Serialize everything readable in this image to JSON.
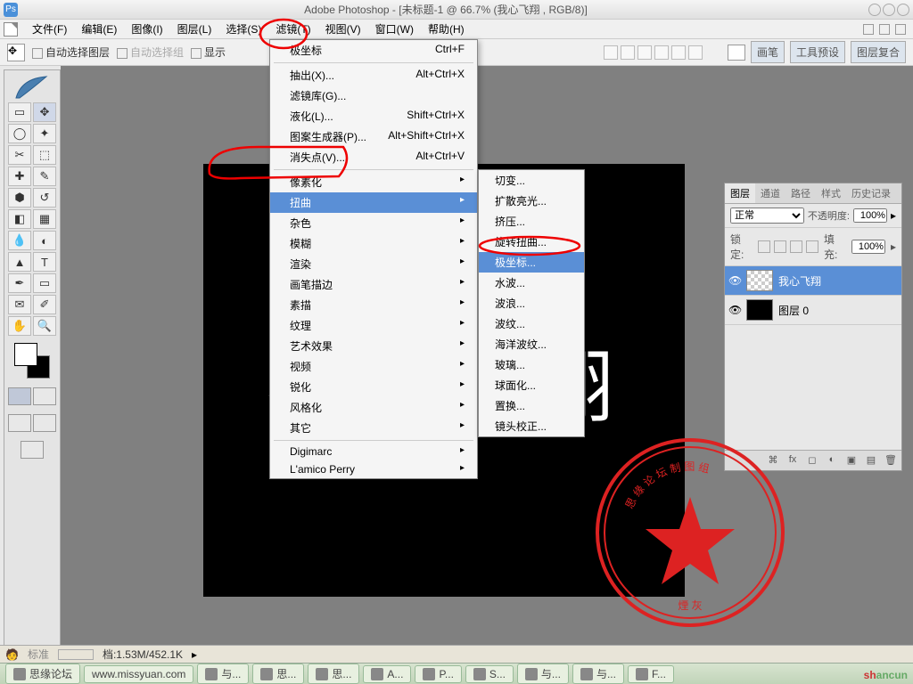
{
  "title": "Adobe Photoshop - [未标题-1 @ 66.7% (我心飞翔  , RGB/8)]",
  "menubar": [
    "文件(F)",
    "编辑(E)",
    "图像(I)",
    "图层(L)",
    "选择(S)",
    "滤镜(T)",
    "视图(V)",
    "窗口(W)",
    "帮助(H)"
  ],
  "optionbar": {
    "auto_select_layer": "自动选择图层",
    "auto_select_group": "自动选择组",
    "show_transform": "显示",
    "right_tabs": [
      "画笔",
      "工具预设",
      "图层复合"
    ]
  },
  "filter_menu": {
    "items": [
      {
        "label": "极坐标",
        "shortcut": "Ctrl+F"
      },
      {
        "sep": true
      },
      {
        "label": "抽出(X)...",
        "shortcut": "Alt+Ctrl+X"
      },
      {
        "label": "滤镜库(G)..."
      },
      {
        "label": "液化(L)...",
        "shortcut": "Shift+Ctrl+X"
      },
      {
        "label": "图案生成器(P)...",
        "shortcut": "Alt+Shift+Ctrl+X"
      },
      {
        "label": "消失点(V)...",
        "shortcut": "Alt+Ctrl+V"
      },
      {
        "sep": true
      },
      {
        "label": "像素化",
        "arrow": true
      },
      {
        "label": "扭曲",
        "arrow": true,
        "highlighted": true
      },
      {
        "label": "杂色",
        "arrow": true
      },
      {
        "label": "模糊",
        "arrow": true
      },
      {
        "label": "渲染",
        "arrow": true
      },
      {
        "label": "画笔描边",
        "arrow": true
      },
      {
        "label": "素描",
        "arrow": true
      },
      {
        "label": "纹理",
        "arrow": true
      },
      {
        "label": "艺术效果",
        "arrow": true
      },
      {
        "label": "视频",
        "arrow": true
      },
      {
        "label": "锐化",
        "arrow": true
      },
      {
        "label": "风格化",
        "arrow": true
      },
      {
        "label": "其它",
        "arrow": true
      },
      {
        "sep": true
      },
      {
        "label": "Digimarc",
        "arrow": true
      },
      {
        "label": "L'amico Perry",
        "arrow": true
      }
    ]
  },
  "distort_submenu": [
    "切变...",
    "扩散亮光...",
    "挤压...",
    "旋转扭曲...",
    "极坐标...",
    "水波...",
    "波浪...",
    "波纹...",
    "海洋波纹...",
    "玻璃...",
    "球面化...",
    "置换...",
    "镜头校正..."
  ],
  "distort_highlighted_index": 4,
  "canvas_text": "我心飞翔",
  "layers": {
    "tabs": [
      "图层",
      "通道",
      "路径",
      "样式",
      "历史记录"
    ],
    "blend_mode": "正常",
    "opacity_label": "不透明度:",
    "opacity_value": "100%",
    "lock_label": "锁定:",
    "fill_label": "填充:",
    "fill_value": "100%",
    "items": [
      {
        "name": "我心飞翔",
        "selected": true,
        "thumb": "checker"
      },
      {
        "name": "图层 0",
        "selected": false,
        "thumb": "black"
      }
    ]
  },
  "stamp": {
    "outer_text": "思 缘 论 坛 制 图 组",
    "bottom_text": "煙 灰"
  },
  "status": {
    "zoom": "标准",
    "doc": "档:1.53M/452.1K"
  },
  "taskbar": [
    "思缘论坛",
    "www.missyuan.com",
    "与...",
    "思...",
    "思...",
    "A...",
    "P...",
    "S...",
    "与...",
    "与...",
    "F..."
  ],
  "brand": "shancun"
}
